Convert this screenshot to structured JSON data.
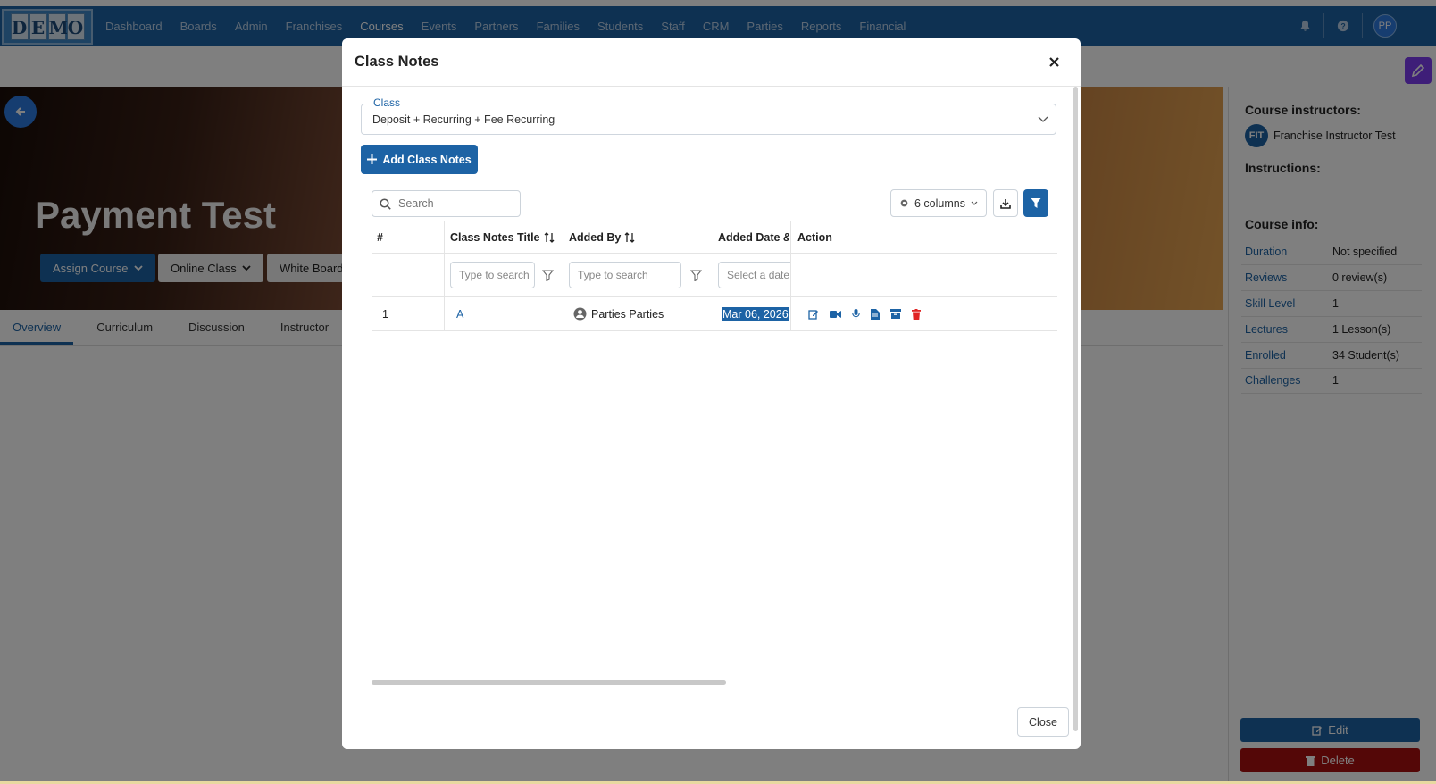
{
  "navbar": {
    "logo_letters": [
      "D",
      "E",
      "M",
      "O"
    ],
    "items": [
      {
        "label": "Dashboard",
        "active": false
      },
      {
        "label": "Boards",
        "active": false
      },
      {
        "label": "Admin",
        "active": false
      },
      {
        "label": "Franchises",
        "active": false
      },
      {
        "label": "Courses",
        "active": true
      },
      {
        "label": "Events",
        "active": false
      },
      {
        "label": "Partners",
        "active": false
      },
      {
        "label": "Families",
        "active": false
      },
      {
        "label": "Students",
        "active": false
      },
      {
        "label": "Staff",
        "active": false
      },
      {
        "label": "CRM",
        "active": false
      },
      {
        "label": "Parties",
        "active": false
      },
      {
        "label": "Reports",
        "active": false
      },
      {
        "label": "Financial",
        "active": false
      }
    ],
    "avatar_initials": "PP"
  },
  "hero": {
    "title": "Payment Test",
    "buttons": {
      "assign": "Assign Course",
      "online": "Online Class",
      "whiteboard": "White Board"
    }
  },
  "tabs": [
    "Overview",
    "Curriculum",
    "Discussion",
    "Instructor"
  ],
  "right_panel": {
    "instructors_heading": "Course instructors:",
    "instructor_initials": "FIT",
    "instructor_name": "Franchise Instructor Test",
    "instructions_heading": "Instructions:",
    "info_heading": "Course info:",
    "info": [
      {
        "key": "Duration",
        "value": "Not specified"
      },
      {
        "key": "Reviews",
        "value": "0 review(s)"
      },
      {
        "key": "Skill Level",
        "value": "1"
      },
      {
        "key": "Lectures",
        "value": "1 Lesson(s)"
      },
      {
        "key": "Enrolled",
        "value": "34 Student(s)"
      },
      {
        "key": "Challenges",
        "value": "1"
      }
    ],
    "edit_label": "Edit",
    "delete_label": "Delete"
  },
  "modal": {
    "title": "Class Notes",
    "class_label": "Class",
    "class_value": "Deposit + Recurring + Fee Recurring",
    "add_button": "Add Class Notes",
    "search_placeholder": "Search",
    "columns_label": "6 columns",
    "headers": {
      "num": "#",
      "title": "Class Notes Title",
      "added_by": "Added By",
      "added_date": "Added Date &",
      "action": "Action"
    },
    "filters": {
      "title_placeholder": "Type to search",
      "added_by_placeholder": "Type to search",
      "date_placeholder": "Select a date"
    },
    "rows": [
      {
        "num": "1",
        "title": "A",
        "added_by": "Parties Parties",
        "added_date": "Mar 06, 2026"
      }
    ],
    "close_label": "Close"
  },
  "colors": {
    "brand": "#1d63a5",
    "danger": "#a80f0f",
    "accent_purple": "#7d3cf0"
  }
}
